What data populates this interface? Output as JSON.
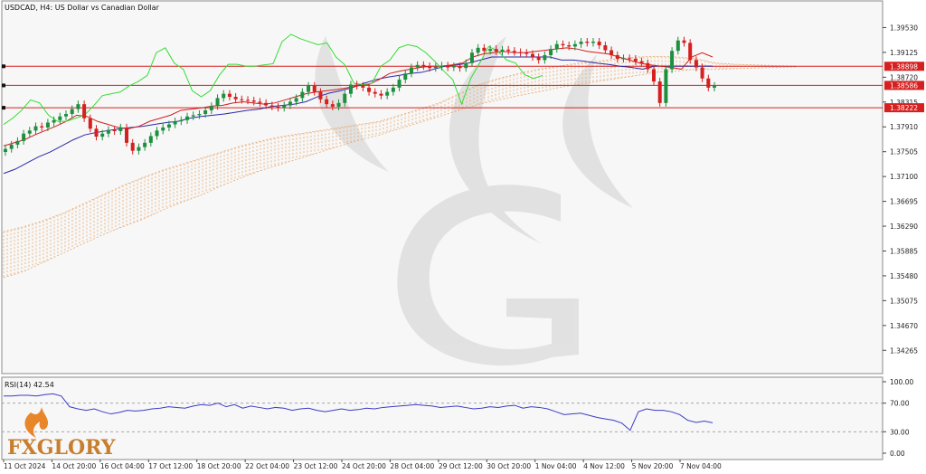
{
  "chart_data": [
    {
      "type": "candlestick",
      "title": "USDCAD, H4:  US Dollar vs Canadian Dollar",
      "price_scale": {
        "min": 1.339,
        "max": 1.3995,
        "tick_values": [
          1.3953,
          1.39125,
          1.3872,
          1.38315,
          1.3791,
          1.37505,
          1.371,
          1.36695,
          1.3629,
          1.35885,
          1.3548,
          1.35075,
          1.3467,
          1.34265
        ],
        "tick_labels": [
          "1.39530",
          "1.39125",
          "1.38720",
          "1.38315",
          "1.37910",
          "1.37505",
          "1.37100",
          "1.36695",
          "1.36290",
          "1.35885",
          "1.35480",
          "1.35075",
          "1.34670",
          "1.34265"
        ]
      },
      "horizontal_lines": [
        {
          "price": 1.38898,
          "label": "1.38898",
          "color": "#d61f1f"
        },
        {
          "price": 1.38586,
          "label": "1.38586",
          "color": "#d61f1f"
        },
        {
          "price": 1.38222,
          "label": "1.38222",
          "color": "#d61f1f"
        }
      ],
      "time_labels": [
        "11 Oct 2024",
        "14 Oct 20:00",
        "16 Oct 04:00",
        "17 Oct 12:00",
        "18 Oct 20:00",
        "22 Oct 04:00",
        "23 Oct 12:00",
        "24 Oct 20:00",
        "28 Oct 04:00",
        "29 Oct 12:00",
        "30 Oct 20:00",
        "1 Nov 04:00",
        "4 Nov 12:00",
        "5 Nov 20:00",
        "7 Nov 04:00"
      ],
      "close_series": [
        1.3755,
        1.3762,
        1.3768,
        1.378,
        1.3785,
        1.3792,
        1.379,
        1.3798,
        1.3802,
        1.3808,
        1.3812,
        1.382,
        1.3828,
        1.3805,
        1.3788,
        1.3775,
        1.378,
        1.3786,
        1.3784,
        1.379,
        1.3765,
        1.3752,
        1.3758,
        1.3765,
        1.3776,
        1.3785,
        1.379,
        1.3795,
        1.38,
        1.3802,
        1.3808,
        1.381,
        1.3812,
        1.3818,
        1.3825,
        1.3838,
        1.3845,
        1.384,
        1.3836,
        1.3835,
        1.3834,
        1.3832,
        1.383,
        1.3826,
        1.3824,
        1.3822,
        1.3826,
        1.3832,
        1.3838,
        1.3848,
        1.3858,
        1.3848,
        1.3836,
        1.3828,
        1.3824,
        1.383,
        1.3845,
        1.386,
        1.3858,
        1.3855,
        1.3848,
        1.3845,
        1.3842,
        1.3848,
        1.3855,
        1.3868,
        1.3878,
        1.3888,
        1.3892,
        1.389,
        1.3887,
        1.3889,
        1.3891,
        1.3888,
        1.389,
        1.3887,
        1.3895,
        1.3912,
        1.392,
        1.3915,
        1.3918,
        1.3914,
        1.3917,
        1.3915,
        1.3913,
        1.3912,
        1.391,
        1.3905,
        1.39,
        1.3908,
        1.3918,
        1.3926,
        1.3924,
        1.3922,
        1.3926,
        1.393,
        1.3928,
        1.393,
        1.3924,
        1.3916,
        1.3908,
        1.3902,
        1.3903,
        1.3902,
        1.3898,
        1.3895,
        1.3885,
        1.3865,
        1.383,
        1.3885,
        1.3915,
        1.3932,
        1.3928,
        1.39,
        1.3888,
        1.387,
        1.3855,
        1.3858
      ],
      "tenkan_sen": [
        1.376,
        1.3765,
        1.377,
        1.3778,
        1.3785,
        1.3792,
        1.38,
        1.381,
        1.3808,
        1.38,
        1.3795,
        1.379,
        1.3788,
        1.3792,
        1.38,
        1.3805,
        1.381,
        1.3818,
        1.382,
        1.3822,
        1.3825,
        1.3826,
        1.383,
        1.3832,
        1.383,
        1.3828,
        1.383,
        1.3835,
        1.384,
        1.3845,
        1.3848,
        1.385,
        1.3852,
        1.3855,
        1.3858,
        1.386,
        1.3868,
        1.3878,
        1.3882,
        1.3885,
        1.3888,
        1.389,
        1.389,
        1.3892,
        1.3895,
        1.3905,
        1.391,
        1.3912,
        1.3914,
        1.3912,
        1.3912,
        1.3914,
        1.3916,
        1.3918,
        1.392,
        1.3918,
        1.3914,
        1.3912,
        1.391,
        1.3905,
        1.39,
        1.3895,
        1.3892,
        1.389,
        1.3888,
        1.3885,
        1.3905,
        1.3912,
        1.3905
      ],
      "kijun_sen": [
        1.3715,
        1.3722,
        1.3732,
        1.3742,
        1.375,
        1.376,
        1.377,
        1.3778,
        1.3782,
        1.3785,
        1.3788,
        1.379,
        1.3792,
        1.3795,
        1.3798,
        1.38,
        1.3805,
        1.3808,
        1.381,
        1.3812,
        1.3815,
        1.3818,
        1.382,
        1.3824,
        1.3826,
        1.3828,
        1.3832,
        1.384,
        1.3846,
        1.385,
        1.3855,
        1.3862,
        1.3868,
        1.3872,
        1.3875,
        1.3878,
        1.388,
        1.3885,
        1.389,
        1.3892,
        1.3895,
        1.39,
        1.3905,
        1.3905,
        1.3905,
        1.3905,
        1.3905,
        1.3905,
        1.39,
        1.39,
        1.3898,
        1.3895,
        1.3893,
        1.389,
        1.3888,
        1.3885,
        1.389,
        1.389,
        1.389,
        1.389,
        1.389,
        1.389
      ],
      "chikou_span": [
        1.3795,
        1.3805,
        1.3818,
        1.3835,
        1.383,
        1.381,
        1.38,
        1.38,
        1.3805,
        1.381,
        1.3825,
        1.3842,
        1.3845,
        1.3848,
        1.3858,
        1.3865,
        1.3875,
        1.3912,
        1.392,
        1.3895,
        1.3885,
        1.385,
        1.384,
        1.385,
        1.3875,
        1.3893,
        1.3893,
        1.389,
        1.389,
        1.3892,
        1.3894,
        1.393,
        1.3942,
        1.3935,
        1.393,
        1.3925,
        1.3928,
        1.3905,
        1.3892,
        1.3862,
        1.386,
        1.3862,
        1.389,
        1.39,
        1.392,
        1.3925,
        1.3922,
        1.3912,
        1.3898,
        1.3882,
        1.3868,
        1.3828,
        1.387,
        1.3895,
        1.3922,
        1.3915,
        1.39,
        1.3895,
        1.3876,
        1.387,
        1.3875
      ],
      "kumo": {
        "senkou_a": [
          1.362,
          1.3628,
          1.3638,
          1.365,
          1.3665,
          1.368,
          1.3695,
          1.3708,
          1.372,
          1.373,
          1.374,
          1.375,
          1.376,
          1.3768,
          1.3775,
          1.378,
          1.3785,
          1.379,
          1.3795,
          1.38,
          1.381,
          1.382,
          1.383,
          1.3845,
          1.386,
          1.387,
          1.3878,
          1.3885,
          1.389,
          1.3895,
          1.3898,
          1.3902,
          1.3905,
          1.3906,
          1.3905,
          1.3902,
          1.3895,
          1.3893,
          1.3892,
          1.3891,
          1.389
        ],
        "senkou_b": [
          1.3545,
          1.3555,
          1.357,
          1.3585,
          1.36,
          1.3615,
          1.3628,
          1.364,
          1.3655,
          1.3668,
          1.368,
          1.3695,
          1.3708,
          1.372,
          1.373,
          1.374,
          1.375,
          1.376,
          1.377,
          1.3778,
          1.3788,
          1.3798,
          1.3808,
          1.3818,
          1.3828,
          1.3835,
          1.3842,
          1.3848,
          1.3855,
          1.386,
          1.3865,
          1.387,
          1.3875,
          1.388,
          1.3882,
          1.3885,
          1.3885,
          1.3886,
          1.3887,
          1.3888,
          1.3889
        ]
      }
    },
    {
      "type": "line",
      "title": "RSI(14) 42.54",
      "ylim": [
        0,
        100
      ],
      "tick_labels": [
        "100.00",
        "70.00",
        "30.00",
        "0.00"
      ],
      "levels": [
        70,
        30
      ],
      "values": [
        80,
        80,
        81,
        81,
        80,
        82,
        83,
        80,
        65,
        62,
        60,
        62,
        58,
        55,
        57,
        60,
        59,
        60,
        62,
        63,
        65,
        64,
        63,
        66,
        68,
        67,
        70,
        65,
        68,
        63,
        66,
        64,
        62,
        64,
        63,
        60,
        62,
        63,
        60,
        58,
        60,
        62,
        60,
        61,
        63,
        62,
        64,
        65,
        66,
        67,
        68,
        67,
        66,
        64,
        65,
        66,
        64,
        62,
        63,
        65,
        64,
        66,
        67,
        63,
        65,
        64,
        62,
        58,
        54,
        55,
        56,
        53,
        50,
        48,
        46,
        42,
        32,
        58,
        62,
        60,
        60,
        58,
        54,
        46,
        43,
        45,
        42.54
      ]
    }
  ],
  "brand": {
    "logo_text": "FXGLORY"
  },
  "colors": {
    "bull": "#1e8f3e",
    "bear": "#d61f1f",
    "tenkan": "#d41c1c",
    "kijun": "#2a2aa8",
    "chikou": "#33dd33",
    "kumo": "#e8a86e",
    "rsi": "#3c3cc8",
    "hline": "#d61f1f"
  }
}
